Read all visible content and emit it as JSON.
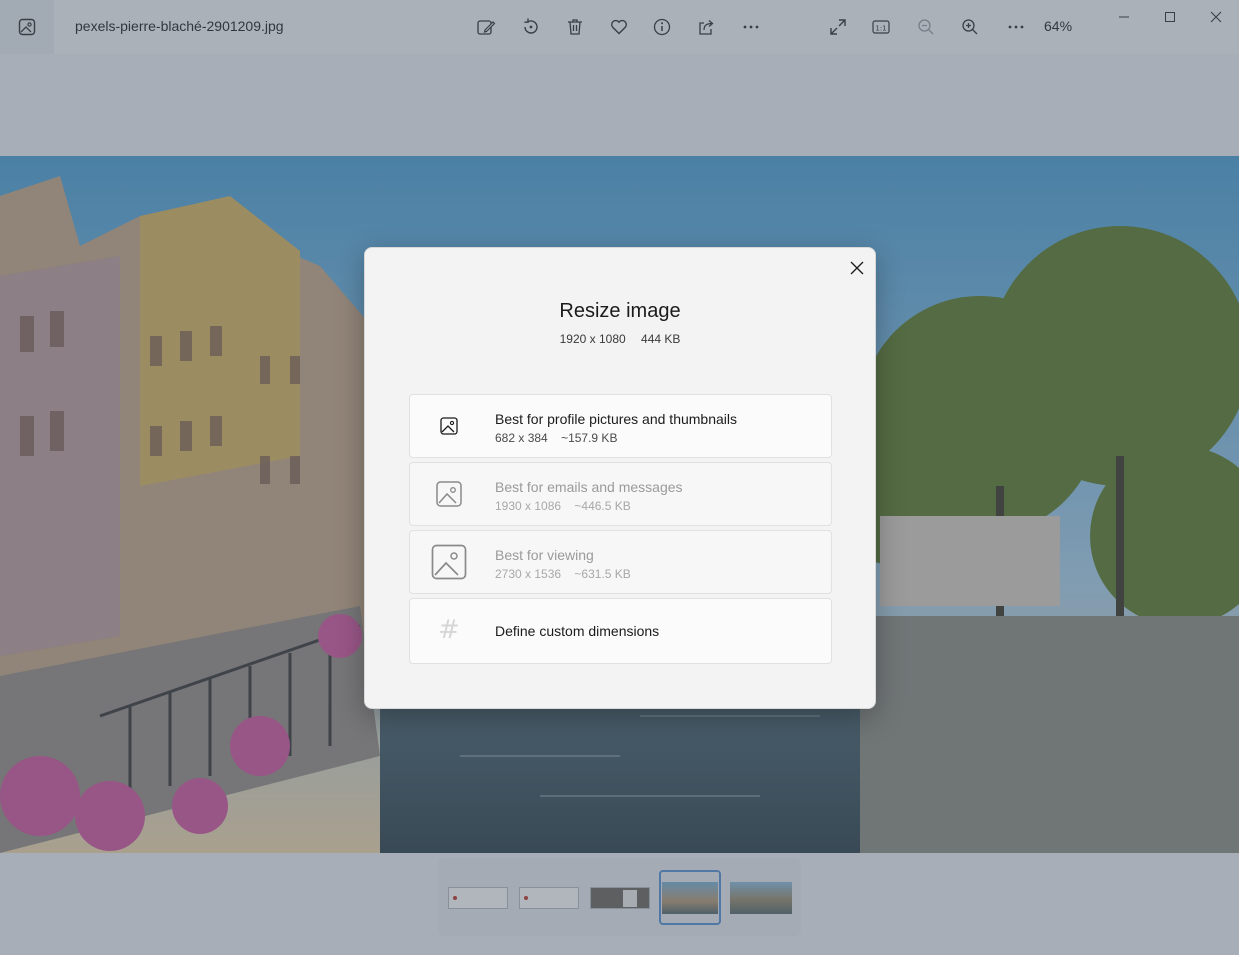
{
  "app": {
    "filename": "pexels-pierre-blaché-2901209.jpg",
    "zoom": "64%"
  },
  "toolbar": {
    "icons": [
      "edit-image-icon",
      "rotate-icon",
      "delete-icon",
      "favorite-icon",
      "info-icon",
      "share-icon",
      "more-icon",
      "fullscreen-icon",
      "actual-size-icon",
      "zoom-out-icon",
      "zoom-in-icon",
      "more-icon"
    ]
  },
  "dialog": {
    "title": "Resize image",
    "dimensions": "1920 x 1080",
    "size": "444 KB",
    "options": [
      {
        "title": "Best for profile pictures and thumbnails",
        "dimensions": "682 x 384",
        "size": "~157.9 KB",
        "enabled": true
      },
      {
        "title": "Best for emails and messages",
        "dimensions": "1930 x 1086",
        "size": "~446.5 KB",
        "enabled": false
      },
      {
        "title": "Best for viewing",
        "dimensions": "2730 x 1536",
        "size": "~631.5 KB",
        "enabled": false
      }
    ],
    "custom": "Define custom dimensions"
  },
  "filmstrip": {
    "selected_index": 3,
    "count": 5
  },
  "colors": {
    "accent": "#5b95d6",
    "scrim": "#46505f"
  }
}
